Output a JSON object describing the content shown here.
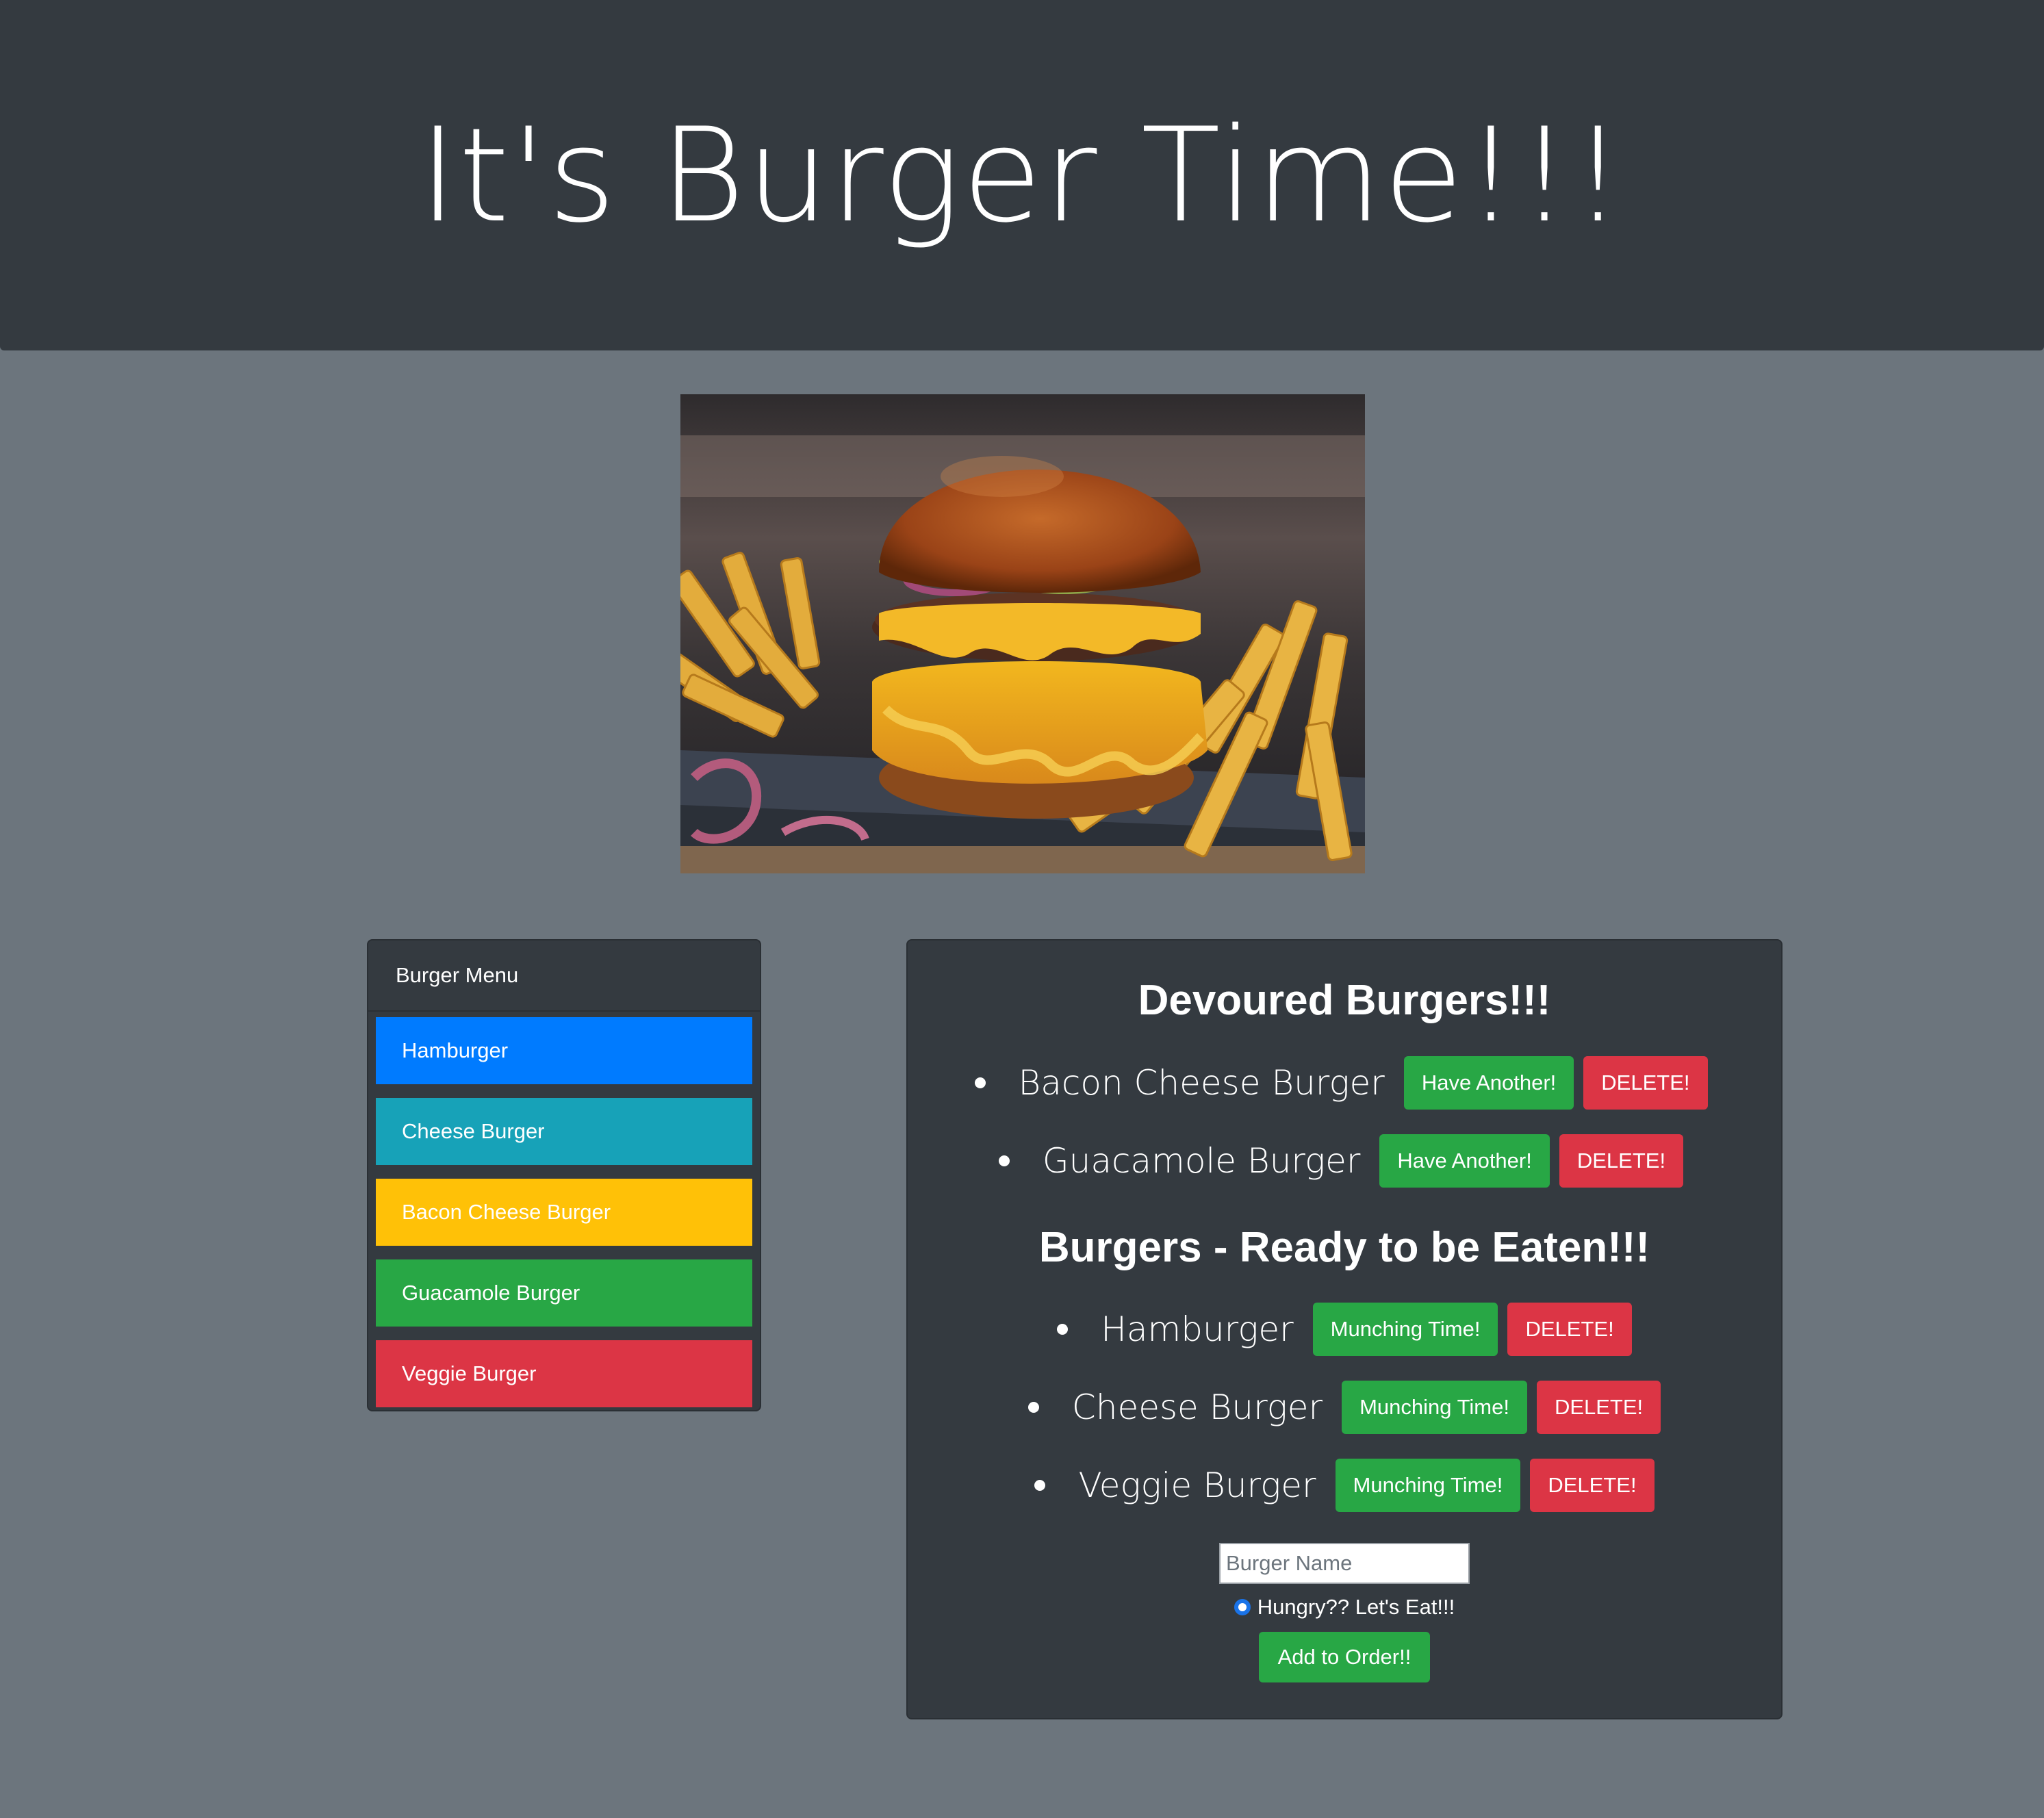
{
  "header": {
    "title": "It's Burger Time!!!"
  },
  "hero": {
    "image": "burger-and-fries-photo"
  },
  "menu": {
    "title": "Burger Menu",
    "items": [
      {
        "label": "Hamburger",
        "color": "#007bff"
      },
      {
        "label": "Cheese Burger",
        "color": "#17a2b8"
      },
      {
        "label": "Bacon Cheese Burger",
        "color": "#ffc107"
      },
      {
        "label": "Guacamole Burger",
        "color": "#28a745"
      },
      {
        "label": "Veggie Burger",
        "color": "#dc3545"
      }
    ]
  },
  "devoured": {
    "title": "Devoured Burgers!!!",
    "action_label": "Have Another!",
    "delete_label": "DELETE!",
    "items": [
      {
        "name": "Bacon Cheese Burger"
      },
      {
        "name": "Guacamole Burger"
      }
    ]
  },
  "ready": {
    "title": "Burgers - Ready to be Eaten!!!",
    "action_label": "Munching Time!",
    "delete_label": "DELETE!",
    "items": [
      {
        "name": "Hamburger"
      },
      {
        "name": "Cheese Burger"
      },
      {
        "name": "Veggie Burger"
      }
    ]
  },
  "form": {
    "placeholder": "Burger Name",
    "radio_label": "Hungry?? Let's Eat!!!",
    "submit_label": "Add to Order!!"
  },
  "colors": {
    "header_bg": "#343a40",
    "page_bg": "#6c757d",
    "success": "#28a745",
    "danger": "#dc3545"
  }
}
